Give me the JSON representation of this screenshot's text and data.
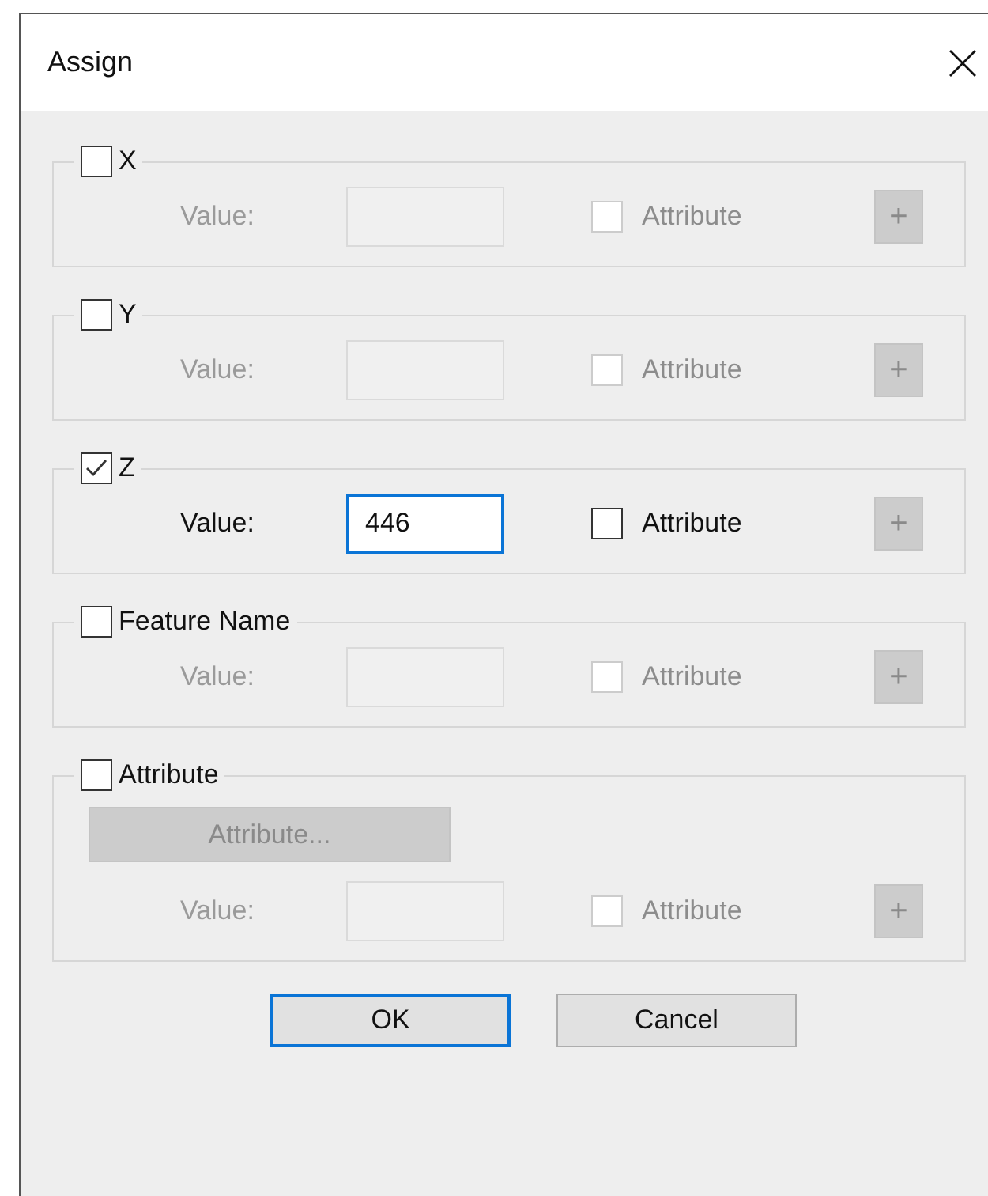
{
  "window": {
    "title": "Assign"
  },
  "groups": [
    {
      "kind": "field",
      "label": "X",
      "checked": false,
      "value_label": "Value:",
      "attribute_label": "Attribute",
      "attribute_checked": false,
      "add": "+"
    },
    {
      "kind": "field",
      "label": "Y",
      "checked": false,
      "value_label": "Value:",
      "attribute_label": "Attribute",
      "attribute_checked": false,
      "add": "+"
    },
    {
      "kind": "field",
      "label": "Z",
      "checked": true,
      "value_label": "Value:",
      "value": "446",
      "attribute_label": "Attribute",
      "attribute_checked": false,
      "add": "+"
    },
    {
      "kind": "field",
      "label": "Feature Name",
      "checked": false,
      "value_label": "Value:",
      "attribute_label": "Attribute",
      "attribute_checked": false,
      "add": "+"
    },
    {
      "kind": "attribute",
      "label": "Attribute",
      "checked": false,
      "button": "Attribute...",
      "value_label": "Value:",
      "attribute_label": "Attribute",
      "attribute_checked": false,
      "add": "+"
    }
  ],
  "buttons": [
    {
      "label": "OK",
      "default": true
    },
    {
      "label": "Cancel",
      "default": false
    }
  ]
}
